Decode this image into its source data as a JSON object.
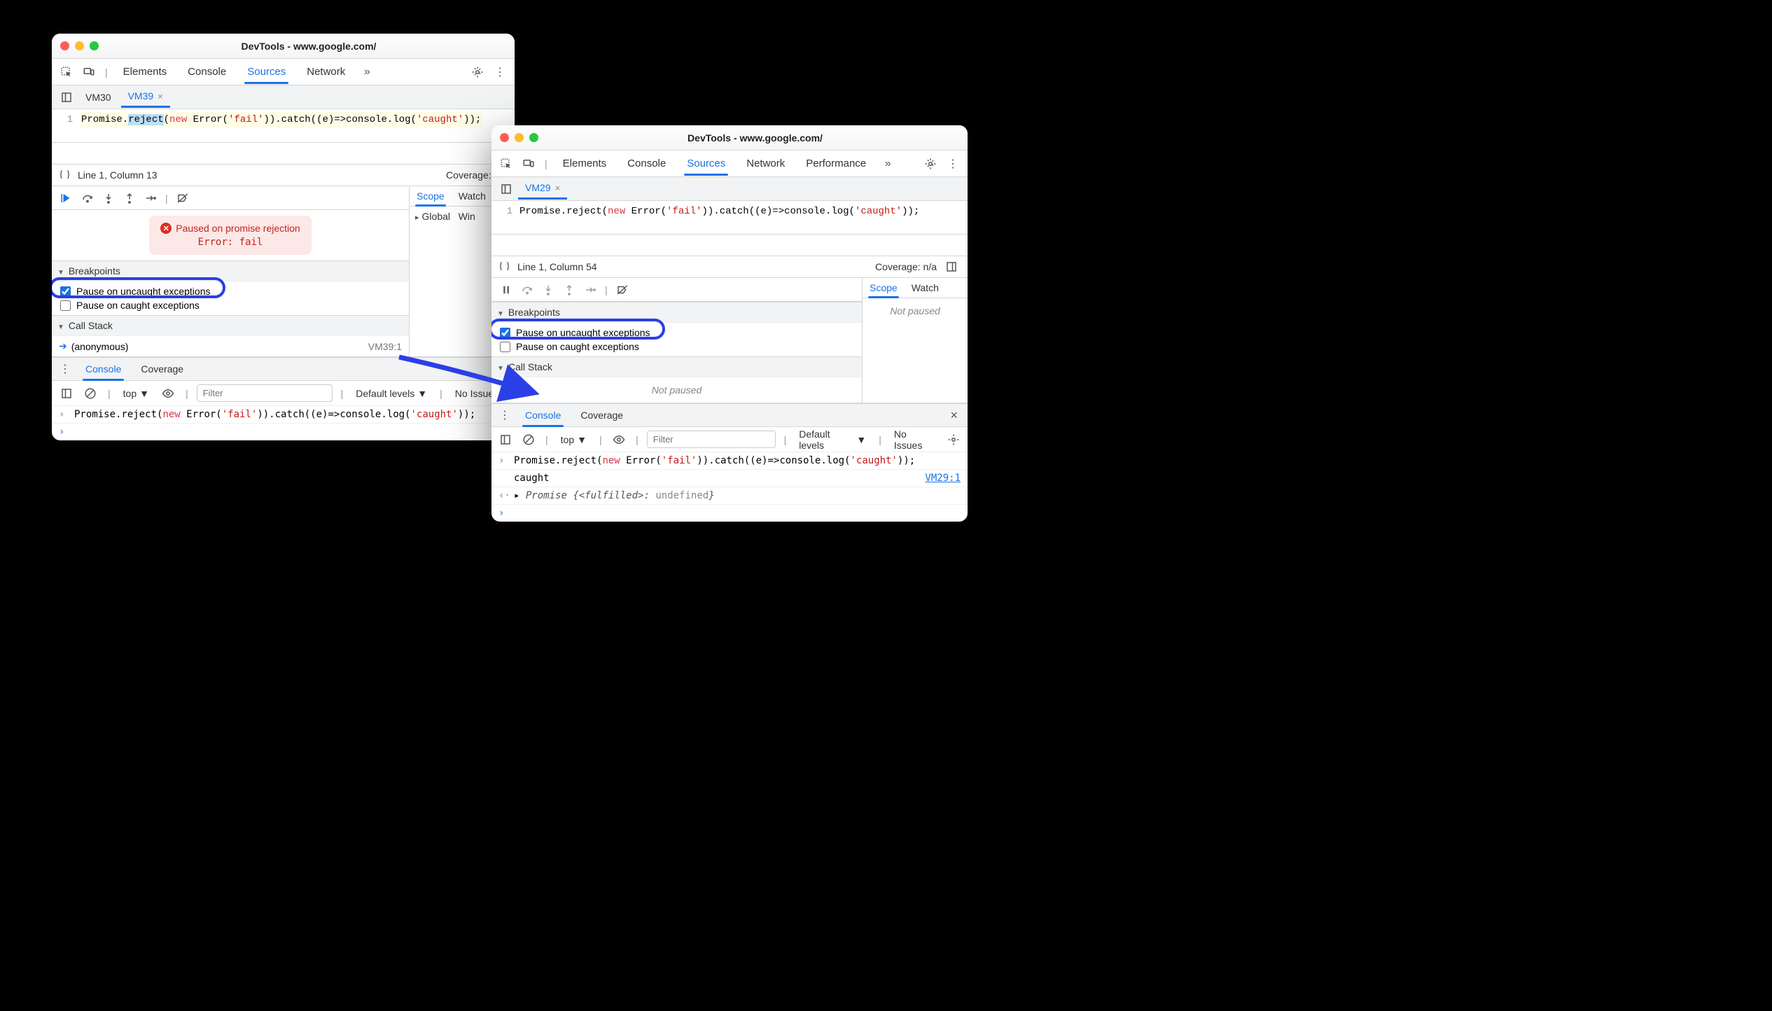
{
  "window_left": {
    "title": "DevTools - www.google.com/",
    "main_tabs": [
      "Elements",
      "Console",
      "Sources",
      "Network"
    ],
    "main_tabs_active": "Sources",
    "file_tabs": [
      {
        "label": "VM30",
        "active": false
      },
      {
        "label": "VM39",
        "active": true
      }
    ],
    "code": {
      "line_no": "1",
      "text_prefix": "Promise.",
      "text_selected": "reject",
      "text_after_sel": "(",
      "kw_new": "new",
      "err_ctor": " Error(",
      "str_fail": "'fail'",
      "mid": ")).catch((e)=>console.log(",
      "str_caught": "'caught'",
      "suffix": "));"
    },
    "status": {
      "left_icon_label": "{ }",
      "pos": "Line 1, Column 13",
      "coverage": "Coverage: n/a"
    },
    "debug_icons": [
      "resume",
      "step-over",
      "step-into",
      "step-out",
      "step",
      "deactivate-breakpoints"
    ],
    "scope_tabs": [
      "Scope",
      "Watch"
    ],
    "scope_tabs_active": "Scope",
    "scope_body": {
      "global": "Global",
      "win": "Win"
    },
    "pause_banner": {
      "line1": "Paused on promise rejection",
      "line2": "Error: fail"
    },
    "breakpoints": {
      "title": "Breakpoints",
      "items": [
        {
          "checked": true,
          "label": "Pause on uncaught exceptions",
          "highlighted": true
        },
        {
          "checked": false,
          "label": "Pause on caught exceptions",
          "highlighted": false
        }
      ]
    },
    "callstack": {
      "title": "Call Stack",
      "frames": [
        {
          "name": "(anonymous)",
          "loc": "VM39:1"
        }
      ]
    },
    "drawer_tabs": [
      "Console",
      "Coverage"
    ],
    "drawer_tabs_active": "Console",
    "console_tb": {
      "top": "top",
      "filter_placeholder": "Filter",
      "levels": "Default levels",
      "issues": "No Issues"
    },
    "console_rows": [
      {
        "mark": "›",
        "code": {
          "p1": "Promise.reject(",
          "kw": "new",
          "p2": " Error(",
          "s1": "'fail'",
          "p3": ")).catch((e)=>console.log(",
          "s2": "'caught'",
          "p4": "));"
        }
      }
    ],
    "prompt": "›"
  },
  "window_right": {
    "title": "DevTools - www.google.com/",
    "main_tabs": [
      "Elements",
      "Console",
      "Sources",
      "Network",
      "Performance"
    ],
    "main_tabs_active": "Sources",
    "file_tabs": [
      {
        "label": "VM29",
        "active": true
      }
    ],
    "code": {
      "line_no": "1",
      "text_prefix": "Promise.reject(",
      "kw_new": "new",
      "err_ctor": " Error(",
      "str_fail": "'fail'",
      "mid": ")).catch((e)=>console.log(",
      "str_caught": "'caught'",
      "suffix": "));"
    },
    "status": {
      "left_icon_label": "{ }",
      "pos": "Line 1, Column 54",
      "coverage": "Coverage: n/a"
    },
    "scope_tabs": [
      "Scope",
      "Watch"
    ],
    "scope_tabs_active": "Scope",
    "scope_not_paused": "Not paused",
    "breakpoints": {
      "title": "Breakpoints",
      "items": [
        {
          "checked": true,
          "label": "Pause on uncaught exceptions",
          "highlighted": true
        },
        {
          "checked": false,
          "label": "Pause on caught exceptions",
          "highlighted": false
        }
      ]
    },
    "callstack": {
      "title": "Call Stack",
      "not_paused": "Not paused"
    },
    "drawer_tabs": [
      "Console",
      "Coverage"
    ],
    "drawer_tabs_active": "Console",
    "console_tb": {
      "top": "top",
      "filter_placeholder": "Filter",
      "levels": "Default levels",
      "issues": "No Issues"
    },
    "console_rows": [
      {
        "mark": "›",
        "type": "code"
      },
      {
        "mark": "",
        "type": "text",
        "text": "caught",
        "link": "VM29:1"
      },
      {
        "mark": "‹·",
        "type": "promise",
        "disc": "▸",
        "obj": "Promise ",
        "state": "{<fulfilled>: ",
        "val": "undefined",
        "end": "}"
      }
    ],
    "prompt": "›"
  }
}
